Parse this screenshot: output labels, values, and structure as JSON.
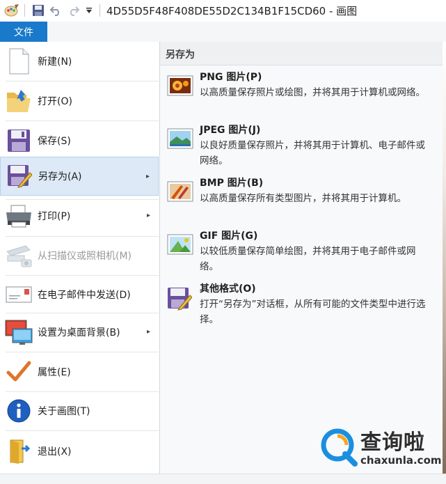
{
  "window": {
    "title": "4D55D5F48F408DE55D2C134B1F15CD60 - 画图"
  },
  "ribbon": {
    "file_tab": "文件"
  },
  "menu": {
    "items": [
      {
        "label": "新建(N)",
        "icon": "new-document-icon"
      },
      {
        "label": "打开(O)",
        "icon": "open-folder-icon"
      },
      {
        "label": "保存(S)",
        "icon": "save-disk-icon"
      },
      {
        "label": "另存为(A)",
        "icon": "save-as-icon",
        "selected": true,
        "submenu": true
      },
      {
        "label": "打印(P)",
        "icon": "printer-icon",
        "submenu": true
      },
      {
        "label": "从扫描仪或照相机(M)",
        "icon": "scanner-icon",
        "disabled": true
      },
      {
        "label": "在电子邮件中发送(D)",
        "icon": "email-icon"
      },
      {
        "label": "设置为桌面背景(B)",
        "icon": "desktop-background-icon",
        "submenu": true
      },
      {
        "label": "属性(E)",
        "icon": "checkmark-icon"
      },
      {
        "label": "关于画图(T)",
        "icon": "info-icon"
      },
      {
        "label": "退出(X)",
        "icon": "exit-icon"
      }
    ],
    "submenu_arrow": "▸"
  },
  "save_as_panel": {
    "title": "另存为",
    "options": [
      {
        "name": "PNG 图片(P)",
        "description": "以高质量保存照片或绘图，并将其用于计算机或网络。",
        "icon": "png-picture-icon"
      },
      {
        "name": "JPEG 图片(J)",
        "description": "以良好质量保存照片，并将其用于计算机、电子邮件或网络。",
        "icon": "jpeg-picture-icon"
      },
      {
        "name": "BMP 图片(B)",
        "description": "以高质量保存所有类型图片，并将其用于计算机。",
        "icon": "bmp-picture-icon"
      },
      {
        "name": "GIF 图片(G)",
        "description": "以较低质量保存简单绘图，并将其用于电子邮件或网络。",
        "icon": "gif-picture-icon"
      },
      {
        "name": "其他格式(O)",
        "description": "打开“另存为”对话框，从所有可能的文件类型中进行选择。",
        "icon": "other-formats-icon"
      }
    ]
  },
  "watermark": {
    "text": "查询啦",
    "url": "chaxunla.com"
  },
  "colors": {
    "file_tab": "#1979ca",
    "selected_item": "#dde9f7",
    "panel_background": "#f8f9fa"
  }
}
